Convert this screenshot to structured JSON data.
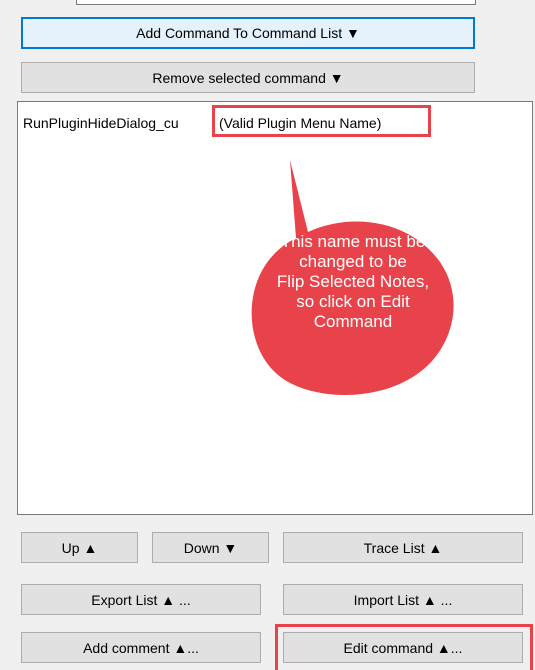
{
  "toolbar": {
    "add_command_label": "Add Command To Command List ▼",
    "remove_command_label": "Remove selected command ▼"
  },
  "command_list": {
    "items": [
      {
        "command": "RunPluginHideDialog_cu",
        "argument": "(Valid Plugin Menu Name)"
      }
    ]
  },
  "callout": {
    "lines": [
      "This name must be",
      "changed to be",
      "Flip Selected Notes,",
      "so click on Edit",
      "Command"
    ]
  },
  "bottom_buttons": {
    "up_label": "Up ▲",
    "down_label": "Down ▼",
    "trace_list_label": "Trace List ▲",
    "export_list_label": "Export List ▲ ...",
    "import_list_label": "Import List ▲ ...",
    "add_comment_label": "Add comment ▲...",
    "edit_command_label": "Edit command ▲..."
  },
  "colors": {
    "annotation_red": "#e8434a",
    "focus_blue": "#0078d7"
  }
}
